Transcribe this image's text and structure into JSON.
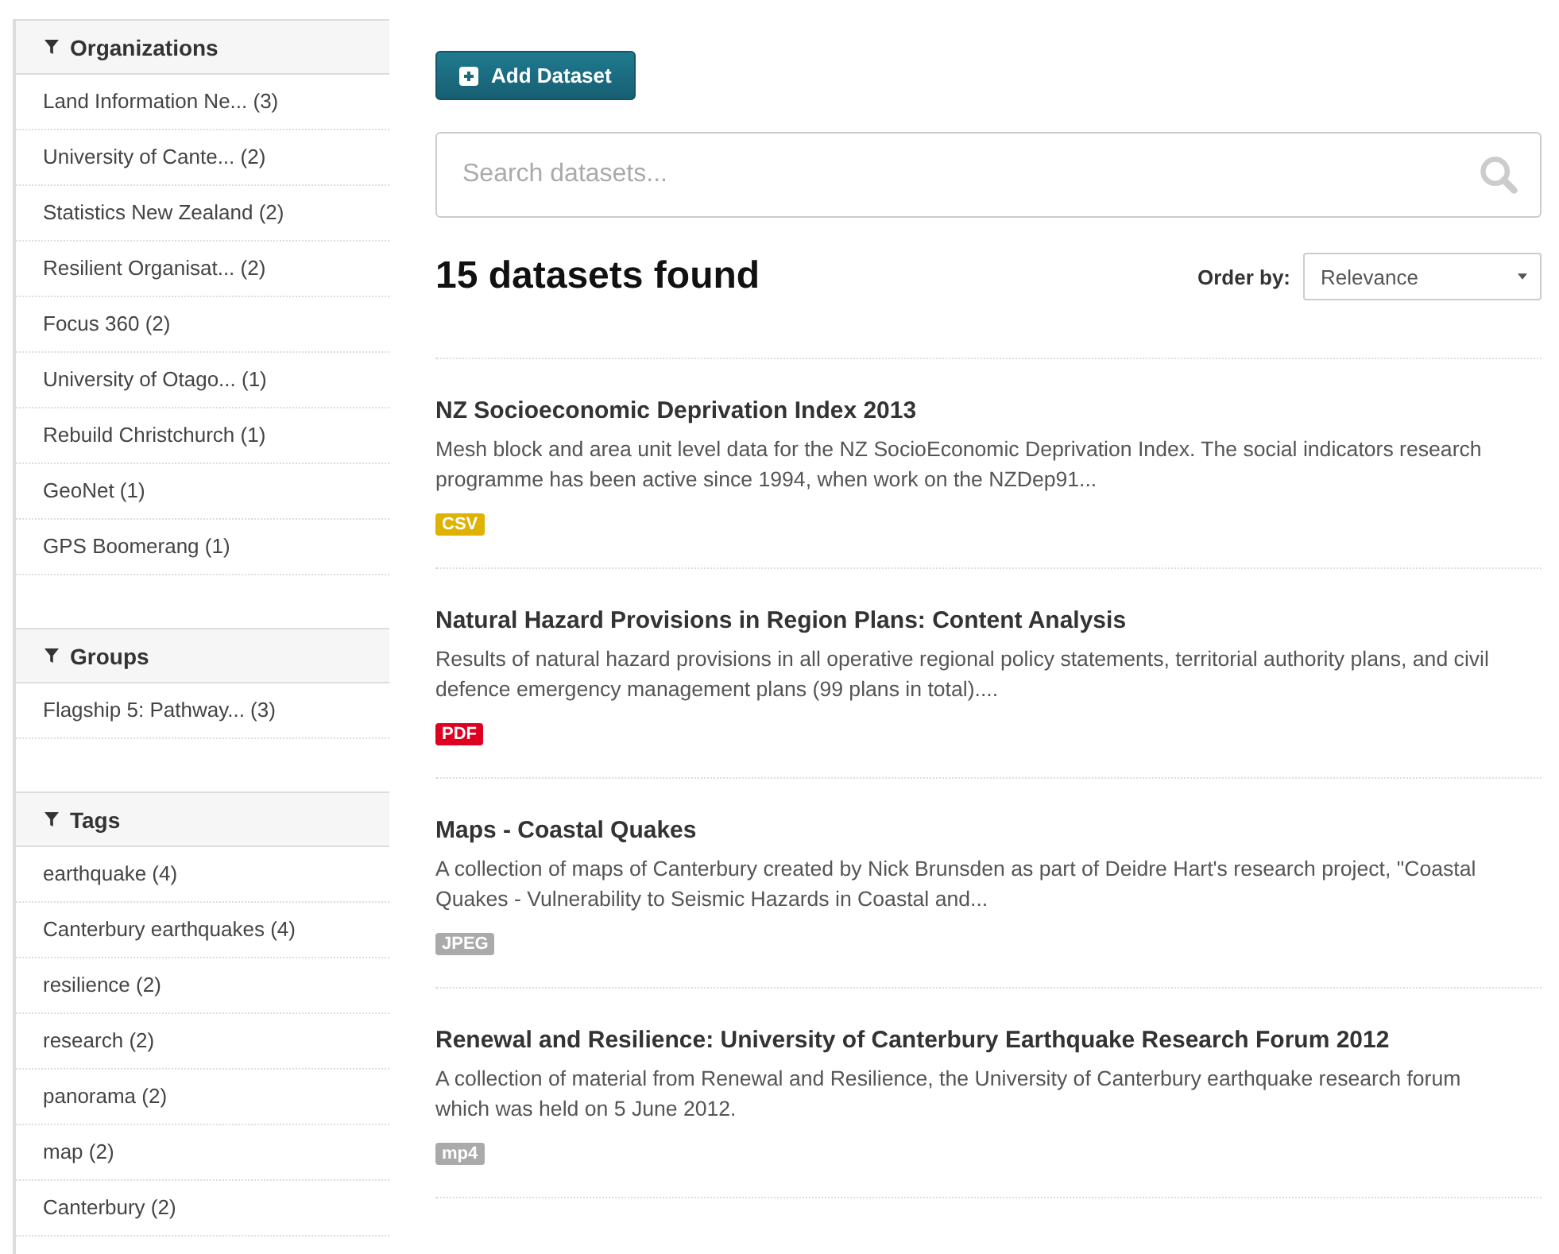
{
  "sidebar": {
    "sections": [
      {
        "title": "Organizations",
        "items": [
          {
            "label": "Land Information Ne... (3)"
          },
          {
            "label": "University of Cante... (2)"
          },
          {
            "label": "Statistics New Zealand (2)"
          },
          {
            "label": "Resilient Organisat... (2)"
          },
          {
            "label": "Focus 360 (2)"
          },
          {
            "label": "University of Otago... (1)"
          },
          {
            "label": "Rebuild Christchurch (1)"
          },
          {
            "label": "GeoNet (1)"
          },
          {
            "label": "GPS Boomerang (1)"
          }
        ]
      },
      {
        "title": "Groups",
        "items": [
          {
            "label": "Flagship 5: Pathway... (3)"
          }
        ]
      },
      {
        "title": "Tags",
        "items": [
          {
            "label": "earthquake (4)"
          },
          {
            "label": "Canterbury earthquakes (4)"
          },
          {
            "label": "resilience (2)"
          },
          {
            "label": "research (2)"
          },
          {
            "label": "panorama (2)"
          },
          {
            "label": "map (2)"
          },
          {
            "label": "Canterbury (2)"
          }
        ]
      }
    ]
  },
  "add_button": "Add Dataset",
  "search": {
    "placeholder": "Search datasets..."
  },
  "result_count": "15 datasets found",
  "order_by": {
    "label": "Order by:",
    "value": "Relevance"
  },
  "datasets": [
    {
      "title": "NZ Socioeconomic Deprivation Index 2013",
      "description": "Mesh block and area unit level data for the NZ SocioEconomic Deprivation Index. The social indicators research programme has been active since 1994, when work on the NZDep91...",
      "format": "CSV",
      "color": "#dfb100"
    },
    {
      "title": "Natural Hazard Provisions in Region Plans: Content Analysis",
      "description": "Results of natural hazard provisions in all operative regional policy statements, territorial authority plans, and civil defence emergency management plans (99 plans in total)....",
      "format": "PDF",
      "color": "#dd0021"
    },
    {
      "title": "Maps - Coastal Quakes",
      "description": "A collection of maps of Canterbury created by Nick Brunsden as part of Deidre Hart's research project, \"Coastal Quakes - Vulnerability to Seismic Hazards in Coastal and...",
      "format": "JPEG",
      "color": "#aaaaaa"
    },
    {
      "title": "Renewal and Resilience: University of Canterbury Earthquake Research Forum 2012",
      "description": "A collection of material from Renewal and Resilience, the University of Canterbury earthquake research forum which was held on 5 June 2012.",
      "format": "mp4",
      "color": "#aaaaaa"
    }
  ]
}
